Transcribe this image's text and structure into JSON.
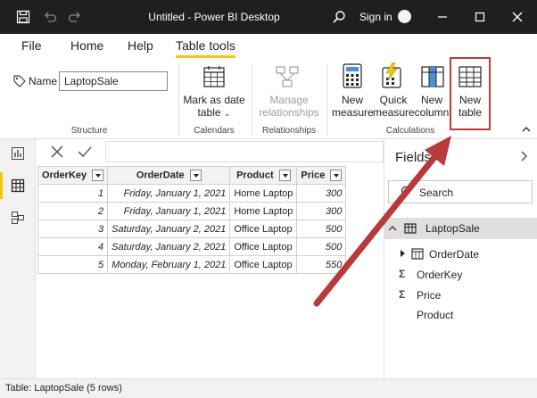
{
  "window": {
    "title": "Untitled - Power BI Desktop",
    "sign_in": "Sign in"
  },
  "tabs": [
    "File",
    "Home",
    "Help",
    "Table tools"
  ],
  "ribbon": {
    "name_label": "Name",
    "name_value": "LaptopSale",
    "groups": [
      "Structure",
      "Calendars",
      "Relationships",
      "Calculations"
    ],
    "mark_as_date": [
      "Mark as date",
      "table"
    ],
    "manage_relationships": [
      "Manage",
      "relationships"
    ],
    "new_measure": [
      "New",
      "measure"
    ],
    "quick_measure": [
      "Quick",
      "measure"
    ],
    "new_column": [
      "New",
      "column"
    ],
    "new_table": [
      "New",
      "table"
    ]
  },
  "table": {
    "columns": [
      "OrderKey",
      "OrderDate",
      "Product",
      "Price"
    ],
    "rows": [
      [
        "1",
        "Friday, January 1, 2021",
        "Home Laptop",
        "300"
      ],
      [
        "2",
        "Friday, January 1, 2021",
        "Home Laptop",
        "300"
      ],
      [
        "3",
        "Saturday, January 2, 2021",
        "Office Laptop",
        "500"
      ],
      [
        "4",
        "Saturday, January 2, 2021",
        "Office Laptop",
        "500"
      ],
      [
        "5",
        "Monday, February 1, 2021",
        "Office Laptop",
        "550"
      ]
    ]
  },
  "fields": {
    "title": "Fields",
    "search_placeholder": "Search",
    "table_name": "LaptopSale",
    "items": [
      "OrderDate",
      "OrderKey",
      "Price",
      "Product"
    ]
  },
  "status": "Table: LaptopSale (5 rows)",
  "colors": {
    "accent": "#f2c811",
    "arrow": "#b83a3a",
    "titlebar": "#1f1f1f"
  }
}
